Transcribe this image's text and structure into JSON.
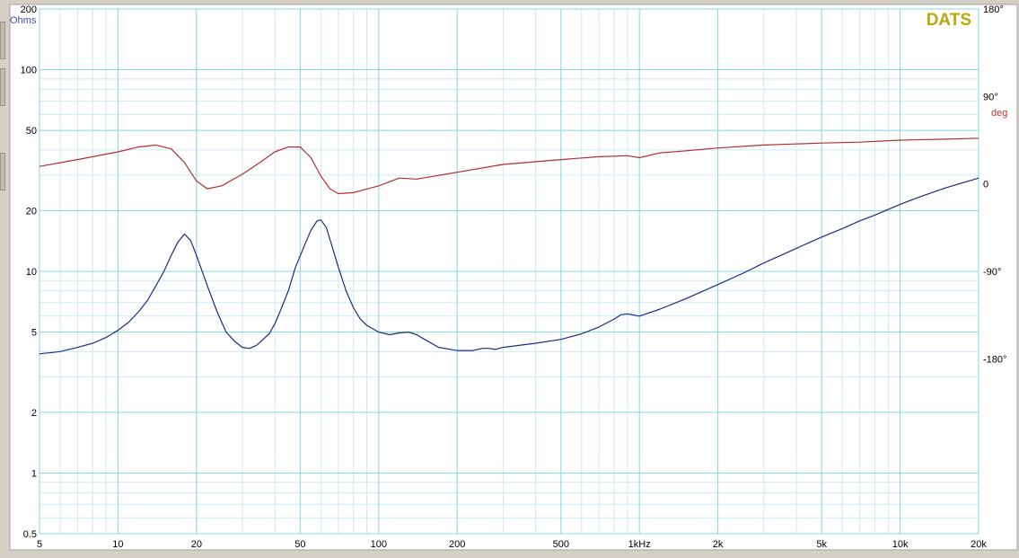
{
  "chart_data": {
    "type": "line",
    "brand": "DATS",
    "x_scale": "log",
    "xlim": [
      5,
      20000
    ],
    "x_ticks": [
      {
        "v": 5,
        "label": "5"
      },
      {
        "v": 10,
        "label": "10"
      },
      {
        "v": 20,
        "label": "20"
      },
      {
        "v": 50,
        "label": "50"
      },
      {
        "v": 100,
        "label": "100"
      },
      {
        "v": 200,
        "label": "200"
      },
      {
        "v": 500,
        "label": "500"
      },
      {
        "v": 1000,
        "label": "1kHz"
      },
      {
        "v": 2000,
        "label": "2k"
      },
      {
        "v": 5000,
        "label": "5k"
      },
      {
        "v": 10000,
        "label": "10k"
      },
      {
        "v": 20000,
        "label": "20k"
      }
    ],
    "y_left": {
      "label": "Ohms",
      "scale": "log",
      "lim": [
        0.5,
        200
      ],
      "ticks": [
        {
          "v": 200,
          "label": "200"
        },
        {
          "v": 100,
          "label": "100"
        },
        {
          "v": 50,
          "label": "50"
        },
        {
          "v": 20,
          "label": "20"
        },
        {
          "v": 10,
          "label": "10"
        },
        {
          "v": 5,
          "label": "5"
        },
        {
          "v": 2,
          "label": "2"
        },
        {
          "v": 1,
          "label": "1"
        },
        {
          "v": 0.5,
          "label": "0.5"
        }
      ]
    },
    "y_right": {
      "label": "deg",
      "scale": "linear",
      "lim": [
        -360,
        180
      ],
      "ticks": [
        {
          "v": 180,
          "label": "180°"
        },
        {
          "v": 90,
          "label": "90°"
        },
        {
          "v": 0,
          "label": "0"
        },
        {
          "v": -90,
          "label": "-90°"
        },
        {
          "v": -180,
          "label": "-180°"
        }
      ]
    },
    "grid": true,
    "series": [
      {
        "axis": "left",
        "color": "#1c2a8a",
        "points": [
          [
            5,
            3.9
          ],
          [
            6,
            4.0
          ],
          [
            7,
            4.2
          ],
          [
            8,
            4.4
          ],
          [
            9,
            4.7
          ],
          [
            10,
            5.1
          ],
          [
            11,
            5.6
          ],
          [
            12,
            6.3
          ],
          [
            13,
            7.2
          ],
          [
            14,
            8.5
          ],
          [
            15,
            10.0
          ],
          [
            16,
            12.0
          ],
          [
            17,
            14.0
          ],
          [
            18,
            15.3
          ],
          [
            19,
            14.2
          ],
          [
            20,
            12.0
          ],
          [
            22,
            8.5
          ],
          [
            24,
            6.3
          ],
          [
            26,
            5.0
          ],
          [
            28,
            4.5
          ],
          [
            30,
            4.2
          ],
          [
            32,
            4.15
          ],
          [
            34,
            4.3
          ],
          [
            36,
            4.6
          ],
          [
            38,
            4.9
          ],
          [
            40,
            5.5
          ],
          [
            42,
            6.4
          ],
          [
            45,
            8.0
          ],
          [
            48,
            10.5
          ],
          [
            52,
            13.5
          ],
          [
            55,
            16.0
          ],
          [
            58,
            17.8
          ],
          [
            60,
            18.0
          ],
          [
            63,
            16.5
          ],
          [
            66,
            13.5
          ],
          [
            70,
            10.5
          ],
          [
            75,
            8.0
          ],
          [
            80,
            6.6
          ],
          [
            85,
            5.8
          ],
          [
            90,
            5.4
          ],
          [
            100,
            5.0
          ],
          [
            110,
            4.85
          ],
          [
            120,
            4.95
          ],
          [
            130,
            5.0
          ],
          [
            140,
            4.85
          ],
          [
            150,
            4.6
          ],
          [
            170,
            4.2
          ],
          [
            200,
            4.05
          ],
          [
            230,
            4.05
          ],
          [
            250,
            4.15
          ],
          [
            265,
            4.15
          ],
          [
            280,
            4.1
          ],
          [
            300,
            4.2
          ],
          [
            400,
            4.4
          ],
          [
            500,
            4.6
          ],
          [
            600,
            4.9
          ],
          [
            700,
            5.3
          ],
          [
            800,
            5.8
          ],
          [
            850,
            6.1
          ],
          [
            900,
            6.15
          ],
          [
            1000,
            6.0
          ],
          [
            1200,
            6.5
          ],
          [
            1500,
            7.3
          ],
          [
            2000,
            8.6
          ],
          [
            2500,
            9.8
          ],
          [
            3000,
            11.0
          ],
          [
            4000,
            13.0
          ],
          [
            5000,
            14.8
          ],
          [
            6000,
            16.3
          ],
          [
            7000,
            17.8
          ],
          [
            8000,
            19.0
          ],
          [
            10000,
            21.5
          ],
          [
            12000,
            23.5
          ],
          [
            15000,
            26.0
          ],
          [
            20000,
            29.0
          ]
        ]
      },
      {
        "axis": "right",
        "color": "#b03030",
        "points": [
          [
            5,
            18
          ],
          [
            7,
            25
          ],
          [
            10,
            33
          ],
          [
            12,
            38
          ],
          [
            14,
            40
          ],
          [
            16,
            36
          ],
          [
            18,
            22
          ],
          [
            20,
            3
          ],
          [
            22,
            -5
          ],
          [
            25,
            -2
          ],
          [
            30,
            10
          ],
          [
            35,
            22
          ],
          [
            40,
            33
          ],
          [
            45,
            38
          ],
          [
            50,
            38
          ],
          [
            55,
            27
          ],
          [
            60,
            8
          ],
          [
            65,
            -5
          ],
          [
            70,
            -10
          ],
          [
            80,
            -9
          ],
          [
            100,
            -2
          ],
          [
            120,
            6
          ],
          [
            140,
            5
          ],
          [
            200,
            12
          ],
          [
            300,
            20
          ],
          [
            500,
            25
          ],
          [
            700,
            28
          ],
          [
            900,
            29
          ],
          [
            1000,
            27
          ],
          [
            1200,
            32
          ],
          [
            1500,
            34
          ],
          [
            2000,
            37
          ],
          [
            3000,
            40
          ],
          [
            5000,
            42
          ],
          [
            7000,
            43
          ],
          [
            10000,
            45
          ],
          [
            15000,
            46
          ],
          [
            20000,
            47
          ]
        ]
      }
    ]
  }
}
